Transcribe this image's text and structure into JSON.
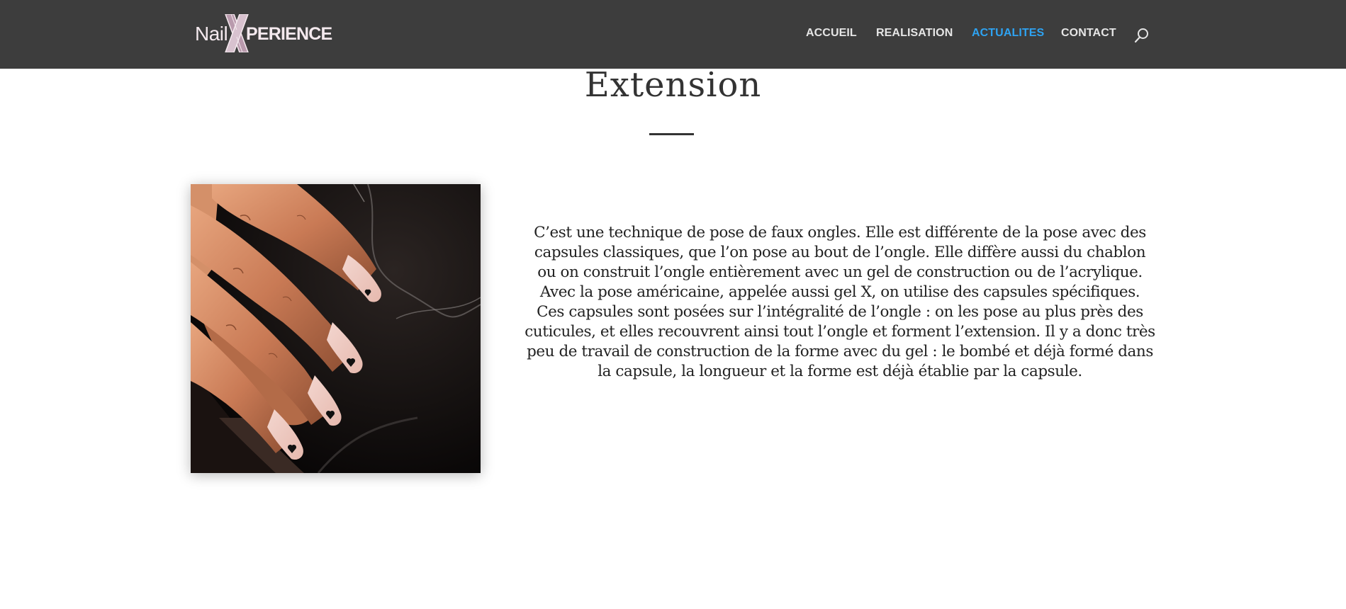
{
  "header": {
    "logo": {
      "text_left": "Nail",
      "text_right": "PERIENCE",
      "text_x": "X",
      "accent": "#c7a6bb"
    },
    "nav": [
      {
        "label": "ACCUEIL",
        "active": false
      },
      {
        "label": "REALISATION",
        "active": false
      },
      {
        "label": "ACTUALITES",
        "active": true
      },
      {
        "label": "CONTACT",
        "active": false
      }
    ],
    "search_icon": "search-icon",
    "colors": {
      "background": "#3d3d3d",
      "nav_text": "#e6e6e6",
      "nav_active": "#2ea3f2"
    }
  },
  "main": {
    "title": "Extension",
    "photo_subject": "manicured-nails-with-heart-accents",
    "description": "C’est une technique de pose de faux ongles. Elle est différente de la pose avec des capsules classiques, que l’on pose au bout de l’ongle. Elle diffère aussi du chablon ou on construit l’ongle entièrement avec un gel de construction ou de l’acrylique. Avec la pose américaine, appelée aussi gel X, on utilise des capsules spécifiques. Ces capsules sont posées sur l’intégralité de l’ongle : on les pose au plus près des cuticules, et elles recouvrent ainsi tout l’ongle et forment l’extension. Il y a donc très peu de travail de construction de la forme avec du gel : le bombé et déjà formé dans la capsule, la longueur et la forme est déjà établie par la capsule."
  }
}
